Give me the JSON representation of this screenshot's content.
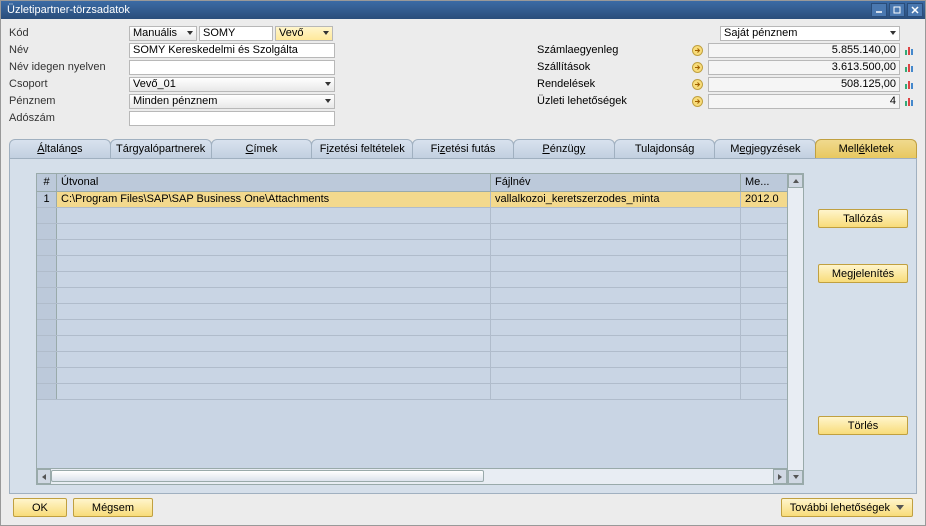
{
  "window": {
    "title": "Üzletipartner-törzsadatok"
  },
  "left": {
    "code_label": "Kód",
    "code_mode": "Manuális",
    "code_value": "SOMY",
    "code_type": "Vevő",
    "name_label": "Név",
    "name_value": "SOMY Kereskedelmi és Szolgálta",
    "foreign_label": "Név idegen nyelven",
    "foreign_value": "",
    "group_label": "Csoport",
    "group_value": "Vevő_01",
    "currency_label": "Pénznem",
    "currency_value": "Minden pénznem",
    "tax_label": "Adószám",
    "tax_value": ""
  },
  "right": {
    "currency_own": "Saját pénznem",
    "balance_label": "Számlaegyenleg",
    "balance_value": "5.855.140,00",
    "deliveries_label": "Szállítások",
    "deliveries_value": "3.613.500,00",
    "orders_label": "Rendelések",
    "orders_value": "508.125,00",
    "opps_label": "Üzleti lehetőségek",
    "opps_value": "4"
  },
  "tabs": {
    "general": "Általános",
    "contacts": "Tárgyalópartnerek",
    "addresses": "Címek",
    "payterms": "Fizetési feltételek",
    "payrun": "Fizetési futás",
    "finance": "Pénzügy",
    "properties": "Tulajdonság",
    "remarks": "Megjegyzések",
    "attachments": "Mellékletek"
  },
  "grid": {
    "h_num": "#",
    "h_path": "Útvonal",
    "h_file": "Fájlnév",
    "h_date": "Me...",
    "rows": [
      {
        "num": "1",
        "path": "C:\\Program Files\\SAP\\SAP Business One\\Attachments",
        "file": "vallalkozoi_keretszerzodes_minta",
        "date": "2012.0"
      }
    ]
  },
  "buttons": {
    "browse": "Tallózás",
    "display": "Megjelenítés",
    "delete": "Törlés",
    "ok": "OK",
    "cancel": "Mégsem",
    "more": "További lehetőségek"
  }
}
